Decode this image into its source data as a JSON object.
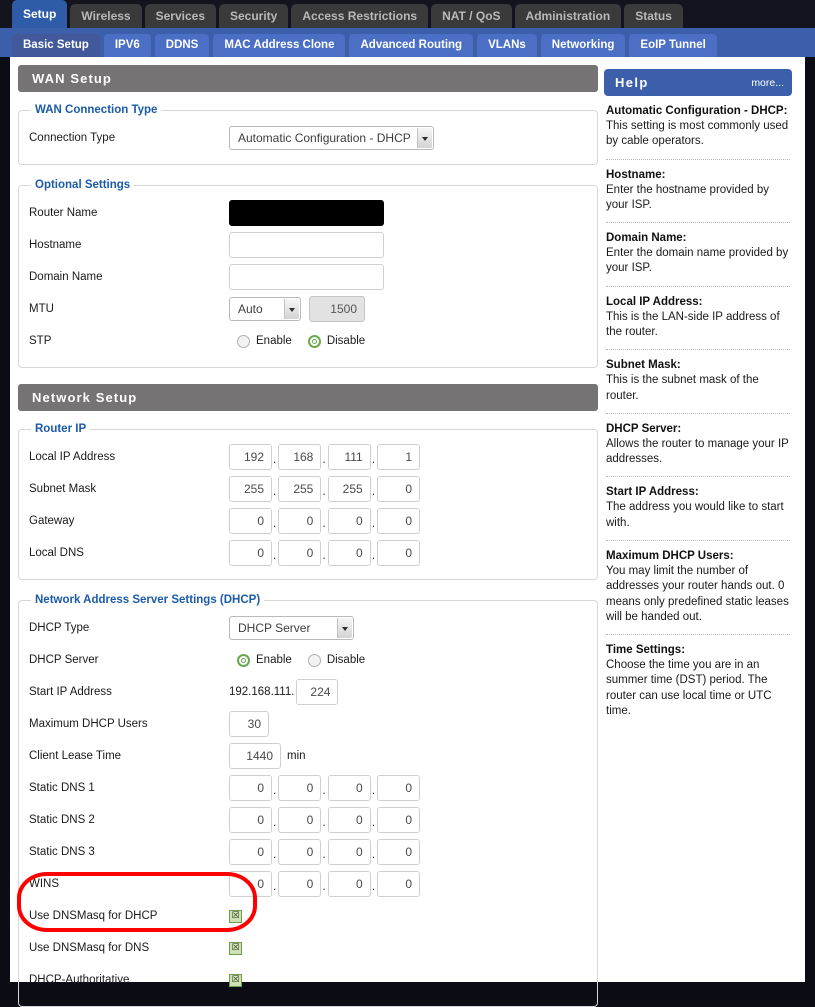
{
  "nav": {
    "tabs": [
      {
        "label": "Setup",
        "active": true
      },
      {
        "label": "Wireless",
        "active": false
      },
      {
        "label": "Services",
        "active": false
      },
      {
        "label": "Security",
        "active": false
      },
      {
        "label": "Access Restrictions",
        "active": false
      },
      {
        "label": "NAT / QoS",
        "active": false
      },
      {
        "label": "Administration",
        "active": false
      },
      {
        "label": "Status",
        "active": false
      }
    ],
    "subtabs": [
      {
        "label": "Basic Setup",
        "active": true
      },
      {
        "label": "IPV6",
        "active": false
      },
      {
        "label": "DDNS",
        "active": false
      },
      {
        "label": "MAC Address Clone",
        "active": false
      },
      {
        "label": "Advanced Routing",
        "active": false
      },
      {
        "label": "VLANs",
        "active": false
      },
      {
        "label": "Networking",
        "active": false
      },
      {
        "label": "EoIP Tunnel",
        "active": false
      }
    ]
  },
  "sections": {
    "wan_setup": "WAN Setup",
    "network_setup": "Network Setup"
  },
  "wan_connection_type": {
    "legend": "WAN Connection Type",
    "connection_type_label": "Connection Type",
    "connection_type_value": "Automatic Configuration - DHCP"
  },
  "optional_settings": {
    "legend": "Optional Settings",
    "router_name_label": "Router Name",
    "router_name_value": "",
    "hostname_label": "Hostname",
    "hostname_value": "",
    "domain_name_label": "Domain Name",
    "domain_name_value": "",
    "mtu_label": "MTU",
    "mtu_mode": "Auto",
    "mtu_value": "1500",
    "stp_label": "STP",
    "stp_enable_label": "Enable",
    "stp_disable_label": "Disable",
    "stp_selected": "Disable"
  },
  "router_ip": {
    "legend": "Router IP",
    "local_ip_label": "Local IP Address",
    "local_ip": [
      "192",
      "168",
      "111",
      "1"
    ],
    "subnet_mask_label": "Subnet Mask",
    "subnet_mask": [
      "255",
      "255",
      "255",
      "0"
    ],
    "gateway_label": "Gateway",
    "gateway": [
      "0",
      "0",
      "0",
      "0"
    ],
    "local_dns_label": "Local DNS",
    "local_dns": [
      "0",
      "0",
      "0",
      "0"
    ]
  },
  "dhcp": {
    "legend": "Network Address Server Settings (DHCP)",
    "dhcp_type_label": "DHCP Type",
    "dhcp_type_value": "DHCP Server",
    "dhcp_server_label": "DHCP Server",
    "dhcp_server_enable_label": "Enable",
    "dhcp_server_disable_label": "Disable",
    "dhcp_server_selected": "Enable",
    "start_ip_label": "Start IP Address",
    "start_ip_prefix": "192.168.111.",
    "start_ip_value": "224",
    "max_users_label": "Maximum DHCP Users",
    "max_users_value": "30",
    "lease_time_label": "Client Lease Time",
    "lease_time_value": "1440",
    "lease_time_unit": "min",
    "static_dns1_label": "Static DNS 1",
    "static_dns1": [
      "0",
      "0",
      "0",
      "0"
    ],
    "static_dns2_label": "Static DNS 2",
    "static_dns2": [
      "0",
      "0",
      "0",
      "0"
    ],
    "static_dns3_label": "Static DNS 3",
    "static_dns3": [
      "0",
      "0",
      "0",
      "0"
    ],
    "wins_label": "WINS",
    "wins": [
      "0",
      "0",
      "0",
      "0"
    ],
    "dnsmasq_dhcp_label": "Use DNSMasq for DHCP",
    "dnsmasq_dhcp_checked": true,
    "dnsmasq_dns_label": "Use DNSMasq for DNS",
    "dnsmasq_dns_checked": true,
    "dhcp_authoritative_label": "DHCP-Authoritative",
    "dhcp_authoritative_checked": true,
    "checkbox_glyph": "☒"
  },
  "help": {
    "title": "Help",
    "more_label": "more...",
    "items": [
      {
        "term": "Automatic Configuration - DHCP:",
        "desc": "This setting is most commonly used by cable operators."
      },
      {
        "term": "Hostname:",
        "desc": "Enter the hostname provided by your ISP."
      },
      {
        "term": "Domain Name:",
        "desc": "Enter the domain name provided by your ISP."
      },
      {
        "term": "Local IP Address:",
        "desc": "This is the LAN-side IP address of the router."
      },
      {
        "term": "Subnet Mask:",
        "desc": "This is the subnet mask of the router."
      },
      {
        "term": "DHCP Server:",
        "desc": "Allows the router to manage your IP addresses."
      },
      {
        "term": "Start IP Address:",
        "desc": "The address you would like to start with."
      },
      {
        "term": "Maximum DHCP Users:",
        "desc": "You may limit the number of addresses your router hands out. 0 means only predefined static leases will be handed out."
      },
      {
        "term": "Time Settings:",
        "desc": "Choose the time you are in an summer time (DST) period. The router can use local time or UTC time."
      }
    ]
  },
  "annotation": {
    "color": "#fe0000",
    "shape": "ellipse-highlight"
  }
}
